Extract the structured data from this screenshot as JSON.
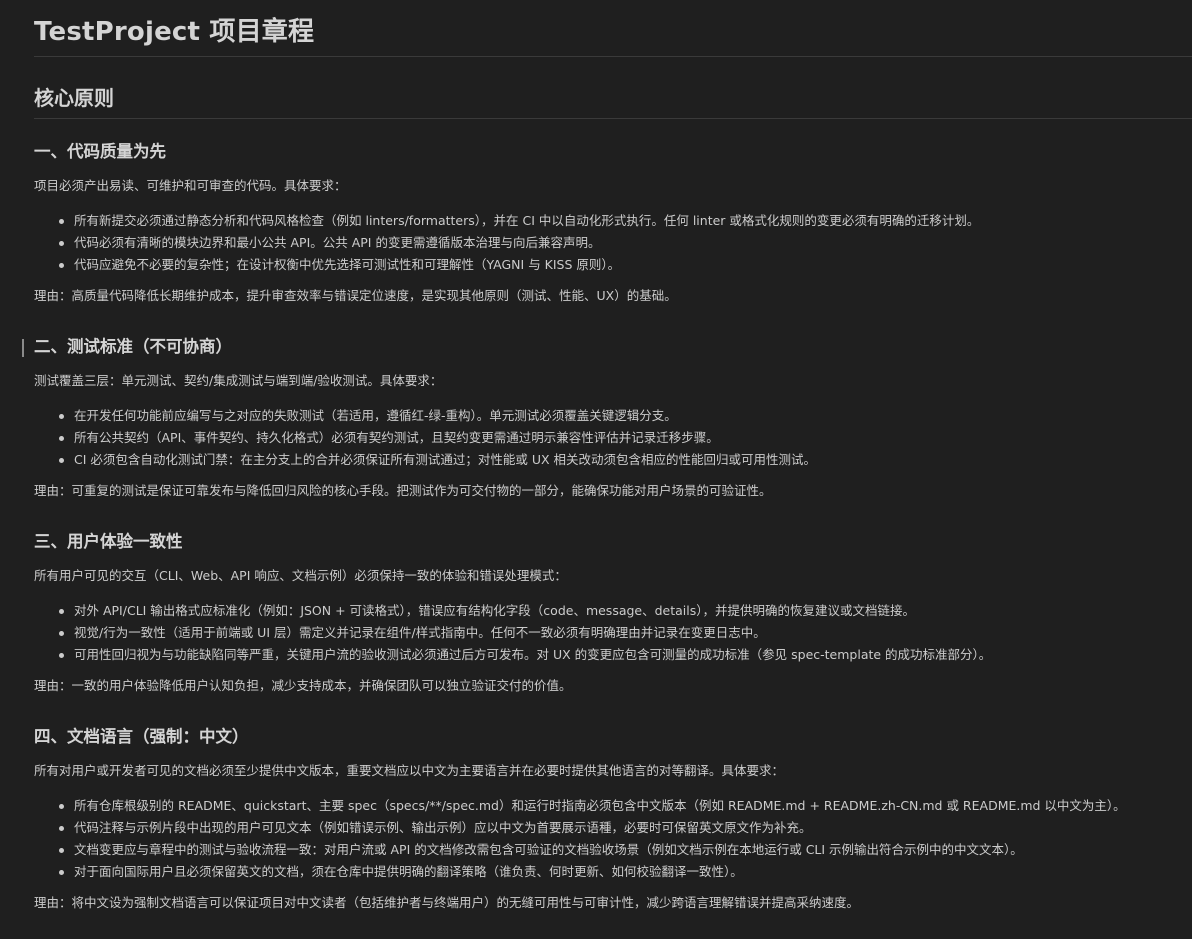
{
  "title": "TestProject 项目章程",
  "core_heading": "核心原则",
  "sections": [
    {
      "heading": "一、代码质量为先",
      "intro": "项目必须产出易读、可维护和可审查的代码。具体要求：",
      "items": [
        "所有新提交必须通过静态分析和代码风格检查（例如 linters/formatters），并在 CI 中以自动化形式执行。任何 linter 或格式化规则的变更必须有明确的迁移计划。",
        "代码必须有清晰的模块边界和最小公共 API。公共 API 的变更需遵循版本治理与向后兼容声明。",
        "代码应避免不必要的复杂性；在设计权衡中优先选择可测试性和可理解性（YAGNI 与 KISS 原则）。"
      ],
      "rationale": "理由：高质量代码降低长期维护成本，提升审查效率与错误定位速度，是实现其他原则（测试、性能、UX）的基础。"
    },
    {
      "heading": "二、测试标准（不可协商）",
      "intro": "测试覆盖三层：单元测试、契约/集成测试与端到端/验收测试。具体要求：",
      "items": [
        "在开发任何功能前应编写与之对应的失败测试（若适用，遵循红-绿-重构）。单元测试必须覆盖关键逻辑分支。",
        "所有公共契约（API、事件契约、持久化格式）必须有契约测试，且契约变更需通过明示兼容性评估并记录迁移步骤。",
        "CI 必须包含自动化测试门禁：在主分支上的合并必须保证所有测试通过；对性能或 UX 相关改动须包含相应的性能回归或可用性测试。"
      ],
      "rationale": "理由：可重复的测试是保证可靠发布与降低回归风险的核心手段。把测试作为可交付物的一部分，能确保功能对用户场景的可验证性。"
    },
    {
      "heading": "三、用户体验一致性",
      "intro": "所有用户可见的交互（CLI、Web、API 响应、文档示例）必须保持一致的体验和错误处理模式：",
      "items": [
        "对外 API/CLI 输出格式应标准化（例如：JSON + 可读格式），错误应有结构化字段（code、message、details），并提供明确的恢复建议或文档链接。",
        "视觉/行为一致性（适用于前端或 UI 层）需定义并记录在组件/样式指南中。任何不一致必须有明确理由并记录在变更日志中。",
        "可用性回归视为与功能缺陷同等严重，关键用户流的验收测试必须通过后方可发布。对 UX 的变更应包含可测量的成功标准（参见 spec-template 的成功标准部分）。"
      ],
      "rationale": "理由：一致的用户体验降低用户认知负担，减少支持成本，并确保团队可以独立验证交付的价值。"
    },
    {
      "heading": "四、文档语言（强制：中文）",
      "intro": "所有对用户或开发者可见的文档必须至少提供中文版本，重要文档应以中文为主要语言并在必要时提供其他语言的对等翻译。具体要求：",
      "items": [
        "所有仓库根级别的 README、quickstart、主要 spec（specs/**/spec.md）和运行时指南必须包含中文版本（例如 README.md + README.zh-CN.md 或 README.md 以中文为主）。",
        "代码注释与示例片段中出现的用户可见文本（例如错误示例、输出示例）应以中文为首要展示语種，必要时可保留英文原文作为补充。",
        "文档变更应与章程中的测试与验收流程一致：对用户流或 API 的文档修改需包含可验证的文档验收场景（例如文档示例在本地运行或 CLI 示例输出符合示例中的中文文本）。",
        "对于面向国际用户且必须保留英文的文档，须在仓库中提供明确的翻译策略（谁负责、何时更新、如何校验翻译一致性）。"
      ],
      "rationale": "理由：将中文设为强制文档语言可以保证项目对中文读者（包括维护者与终端用户）的无缝可用性与可审计性，减少跨语言理解错误并提高采纳速度。"
    }
  ]
}
